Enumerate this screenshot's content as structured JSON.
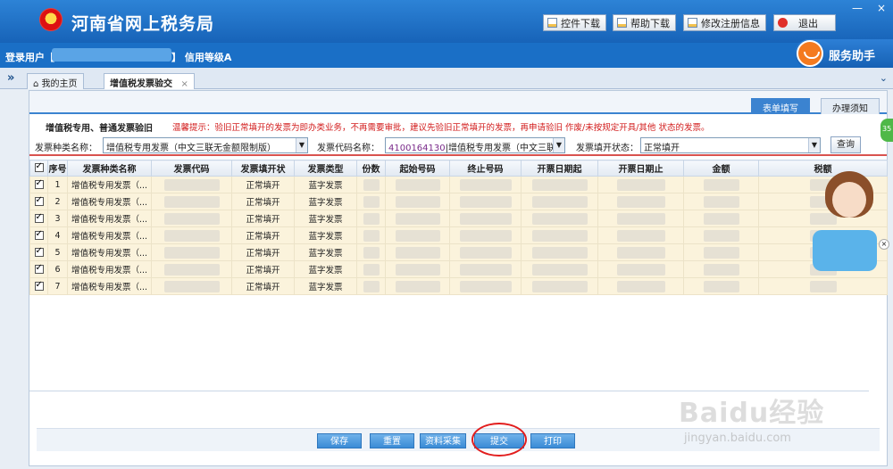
{
  "header": {
    "site_title": "河南省网上税务局",
    "buttons": {
      "control_download": "控件下载",
      "help_download": "帮助下载",
      "edit_registration": "修改注册信息",
      "exit": "退出"
    },
    "window_controls": {
      "minimize": "—",
      "close": "×"
    }
  },
  "userbar": {
    "login_user_prefix": "登录用户【",
    "login_user_suffix": "】 信用等级A",
    "assistant": "服务助手"
  },
  "tabs": {
    "collapse": "»",
    "home": "我的主页",
    "active": "增值税发票验交",
    "close": "×",
    "right_arrow": "⌄"
  },
  "subtabs": {
    "form_fill": "表单填写",
    "instructions": "办理须知"
  },
  "section": {
    "title": "增值税专用、普通发票验旧",
    "notice": "温馨提示：验旧正常填开的发票为即办类业务，不再需要审批，建议先验旧正常填开的发票，再申请验旧 作废/未按规定开具/其他 状态的发票。"
  },
  "filters": {
    "invoice_type_label": "发票种类名称：",
    "invoice_type_value": "增值税专用发票（中文三联无金额限制版）",
    "invoice_code_label": "发票代码名称：",
    "invoice_code_value_code": "4100164130",
    "invoice_code_value_name": "|增值税专用发票（中文三联无",
    "status_label": "发票填开状态：",
    "status_value": "正常填开",
    "query_button": "查询"
  },
  "table": {
    "headers": [
      "序号",
      "发票种类名称",
      "发票代码",
      "发票填开状",
      "发票类型",
      "份数",
      "起始号码",
      "终止号码",
      "开票日期起",
      "开票日期止",
      "金额",
      "税额"
    ],
    "rows": [
      {
        "seq": "1",
        "type_name": "增值税专用发票（...",
        "status": "正常填开",
        "invoice_kind": "蓝字发票"
      },
      {
        "seq": "2",
        "type_name": "增值税专用发票（...",
        "status": "正常填开",
        "invoice_kind": "蓝字发票"
      },
      {
        "seq": "3",
        "type_name": "增值税专用发票（...",
        "status": "正常填开",
        "invoice_kind": "蓝字发票"
      },
      {
        "seq": "4",
        "type_name": "增值税专用发票（...",
        "status": "正常填开",
        "invoice_kind": "蓝字发票"
      },
      {
        "seq": "5",
        "type_name": "增值税专用发票（...",
        "status": "正常填开",
        "invoice_kind": "蓝字发票"
      },
      {
        "seq": "6",
        "type_name": "增值税专用发票（...",
        "status": "正常填开",
        "invoice_kind": "蓝字发票"
      },
      {
        "seq": "7",
        "type_name": "增值税专用发票（...",
        "status": "正常填开",
        "invoice_kind": "蓝字发票"
      }
    ]
  },
  "actions": {
    "save": "保存",
    "reset": "重置",
    "collect": "资料采集",
    "submit": "提交",
    "print": "打印"
  },
  "misc": {
    "edge_badge": "35",
    "chat_close": "×",
    "watermark_main": "Baidu经验",
    "watermark_url": "jingyan.baidu.com"
  }
}
